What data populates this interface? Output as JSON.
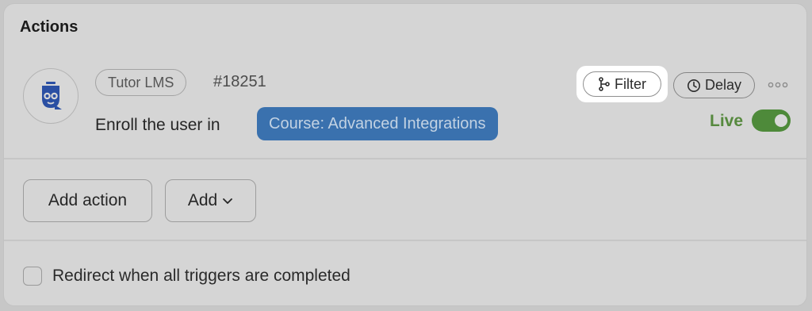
{
  "section": {
    "title": "Actions"
  },
  "action": {
    "source": "Tutor LMS",
    "id": "#18251",
    "description": "Enroll the user in",
    "course_chip": "Course: Advanced Integrations",
    "filter_label": "Filter",
    "delay_label": "Delay",
    "status_label": "Live",
    "live_enabled": true,
    "icons": {
      "app": "tutor-lms-owl-icon",
      "filter": "branch-icon",
      "delay": "clock-icon",
      "more": "more-dots-icon"
    }
  },
  "footer": {
    "add_action_label": "Add action",
    "add_label": "Add",
    "redirect_label": "Redirect when all triggers are completed",
    "redirect_checked": false
  },
  "colors": {
    "chip_background": "#3a71ae",
    "live_green": "#56893e"
  }
}
